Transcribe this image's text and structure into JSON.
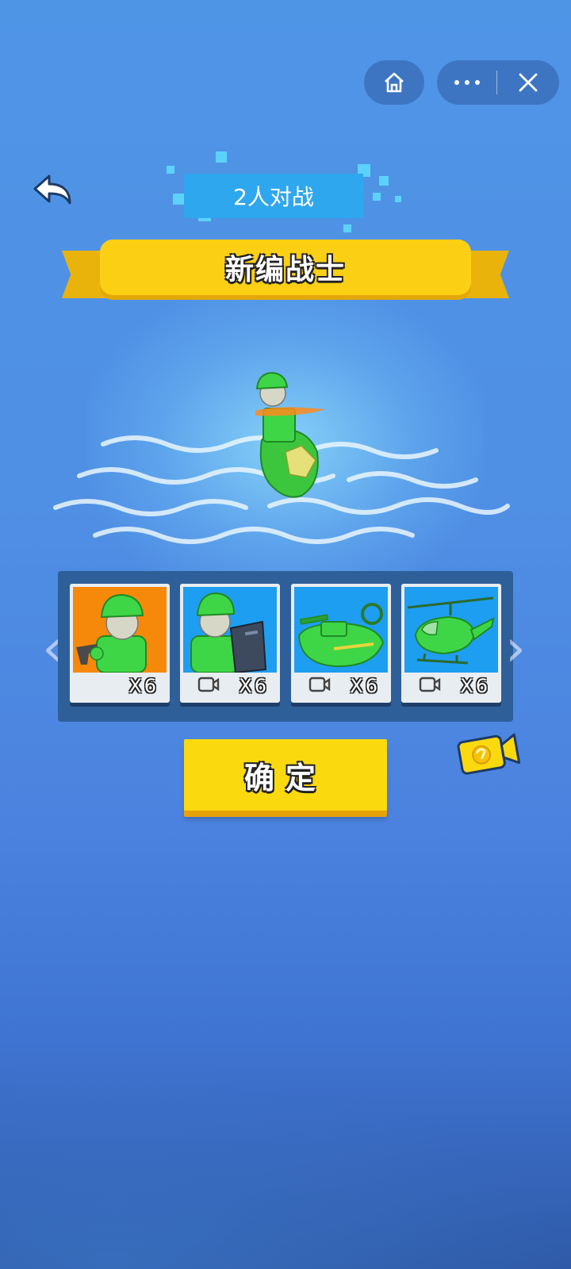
{
  "nav": {
    "home_icon": "home-icon",
    "more_icon": "more-dots-icon",
    "close_icon": "close-icon",
    "back_icon": "back-arrow-icon"
  },
  "mode": {
    "label": "2人对战"
  },
  "title": {
    "label": "新编战士"
  },
  "units": [
    {
      "name": "pistol-soldier",
      "count": "X6",
      "video": false,
      "background": "#f7890a"
    },
    {
      "name": "shield-soldier",
      "count": "X6",
      "video": true,
      "background": "#1e9ef0"
    },
    {
      "name": "tank-boat",
      "count": "X6",
      "video": true,
      "background": "#1e9ef0"
    },
    {
      "name": "helicopter",
      "count": "X6",
      "video": true,
      "background": "#1e9ef0"
    }
  ],
  "confirm": {
    "label": "确定"
  },
  "colors": {
    "accent_yellow": "#fbd90f",
    "soldier_green": "#2ec83a",
    "panel_blue": "#2e5f98"
  }
}
